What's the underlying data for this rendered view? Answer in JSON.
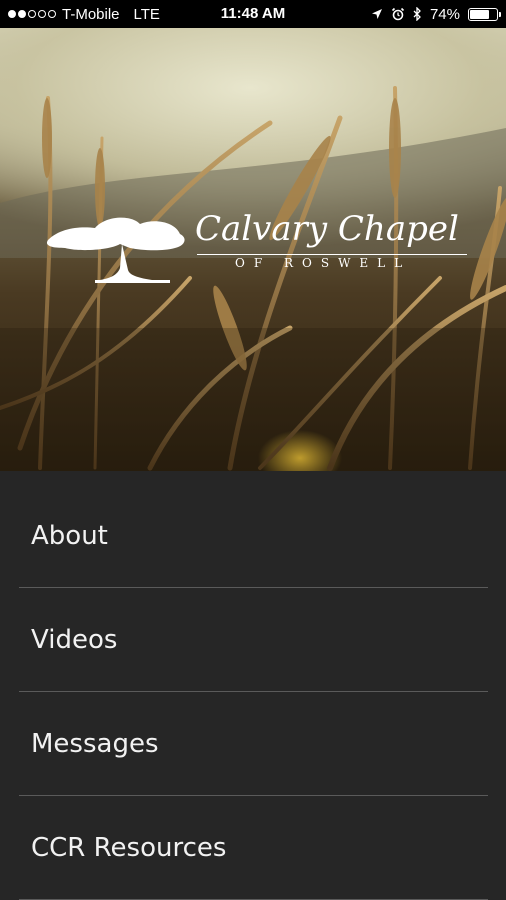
{
  "status_bar": {
    "carrier": "T-Mobile",
    "network": "LTE",
    "time": "11:48 AM",
    "battery_percent": "74%",
    "battery_level": 0.74,
    "signal_bars_filled": 2,
    "signal_bars_total": 5
  },
  "hero": {
    "logo_title": "Calvary Chapel",
    "logo_subtitle": "OF ROSWELL"
  },
  "menu": {
    "items": [
      {
        "label": "About"
      },
      {
        "label": "Videos"
      },
      {
        "label": "Messages"
      },
      {
        "label": "CCR Resources"
      }
    ]
  }
}
